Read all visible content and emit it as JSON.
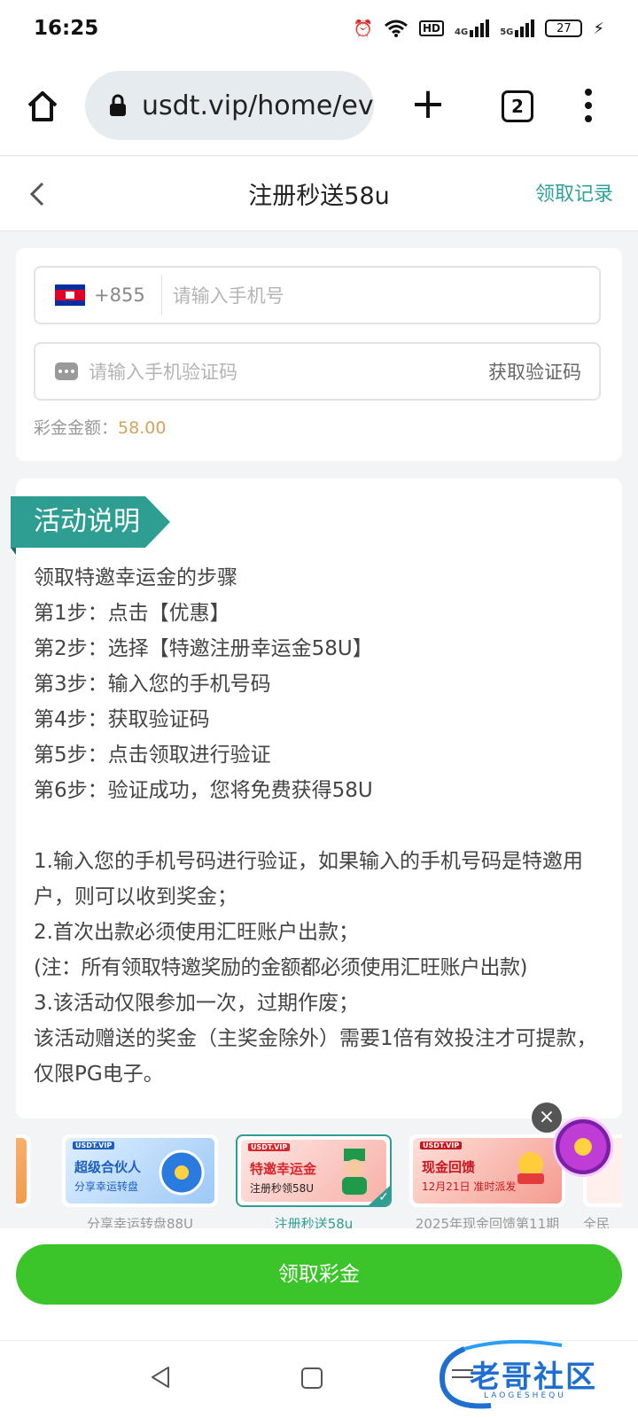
{
  "status_bar": {
    "time": "16:25",
    "network": "HD",
    "signal_1": "4G",
    "signal_2": "5G",
    "battery": "27"
  },
  "browser": {
    "url": "usdt.vip/home/ev",
    "tab_count": "2"
  },
  "header": {
    "title": "注册秒送58u",
    "records_link": "领取记录"
  },
  "form": {
    "dial_code": "+855",
    "phone_placeholder": "请输入手机号",
    "code_placeholder": "请输入手机验证码",
    "get_code_label": "获取验证码",
    "amount_label": "彩金金额：",
    "amount_value": "58.00"
  },
  "activity": {
    "ribbon_title": "活动说明",
    "lines": [
      "领取特邀幸运金的步骤",
      "第1步：点击【优惠】",
      "第2步：选择【特邀注册幸运金58U】",
      "第3步：输入您的手机号码",
      "第4步：获取验证码",
      "第5步：点击领取进行验证",
      "第6步：验证成功，您将免费获得58U",
      "",
      "1.输入您的手机号码进行验证，如果输入的手机号码是特邀用户，则可以收到奖金；",
      "2.首次出款必须使用汇旺账户出款；",
      "(注：所有领取特邀奖励的金额都必须使用汇旺账户出款)",
      "3.该活动仅限参加一次，过期作废；",
      "该活动赠送的奖金（主奖金除外）需要1倍有效投注才可提款，仅限PG电子。"
    ]
  },
  "banners": [
    {
      "tag": "USDT.VIP",
      "title": "超级合伙人",
      "subtitle": "分享幸运转盘",
      "caption": "分享幸运转盘88U"
    },
    {
      "tag": "USDT.VIP",
      "title": "特邀幸运金",
      "subtitle": "注册秒领58U",
      "caption": "注册秒送58u"
    },
    {
      "tag": "USDT.VIP",
      "title": "现金回馈",
      "subtitle": "12月21日 准时派发",
      "caption": "2025年现金回馈第11期"
    },
    {
      "caption": "全民"
    }
  ],
  "claim_button": "领取彩金",
  "watermark": {
    "text": "老哥社区",
    "subtext": "LAOGESHEQU"
  }
}
